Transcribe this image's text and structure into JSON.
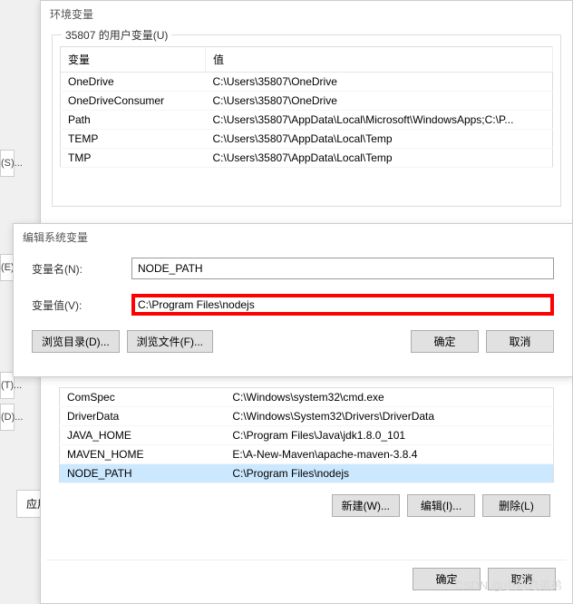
{
  "side_tabs": {
    "s": "(S)...",
    "e": "(E)...",
    "t": "(T)...",
    "d": "(D)..."
  },
  "side_label": "应用",
  "env_window": {
    "title": "环境变量",
    "user_group": "35807 的用户变量(U)",
    "col_var": "变量",
    "col_val": "值",
    "user_rows": [
      {
        "var": "OneDrive",
        "val": "C:\\Users\\35807\\OneDrive"
      },
      {
        "var": "OneDriveConsumer",
        "val": "C:\\Users\\35807\\OneDrive"
      },
      {
        "var": "Path",
        "val": "C:\\Users\\35807\\AppData\\Local\\Microsoft\\WindowsApps;C:\\P..."
      },
      {
        "var": "TEMP",
        "val": "C:\\Users\\35807\\AppData\\Local\\Temp"
      },
      {
        "var": "TMP",
        "val": "C:\\Users\\35807\\AppData\\Local\\Temp"
      }
    ],
    "sys_rows": [
      {
        "var": "ComSpec",
        "val": "C:\\Windows\\system32\\cmd.exe"
      },
      {
        "var": "DriverData",
        "val": "C:\\Windows\\System32\\Drivers\\DriverData"
      },
      {
        "var": "JAVA_HOME",
        "val": "C:\\Program Files\\Java\\jdk1.8.0_101"
      },
      {
        "var": "MAVEN_HOME",
        "val": "E:\\A-New-Maven\\apache-maven-3.8.4"
      },
      {
        "var": "NODE_PATH",
        "val": "C:\\Program Files\\nodejs",
        "sel": true
      }
    ],
    "btn_new": "新建(W)...",
    "btn_edit": "编辑(I)...",
    "btn_del": "删除(L)",
    "btn_ok": "确定",
    "btn_cancel": "取消"
  },
  "edit_window": {
    "title": "编辑系统变量",
    "label_name": "变量名(N):",
    "label_value": "变量值(V):",
    "value_name": "NODE_PATH",
    "value_value": "C:\\Program Files\\nodejs",
    "btn_browse_dir": "浏览目录(D)...",
    "btn_browse_file": "浏览文件(F)...",
    "btn_ok": "确定",
    "btn_cancel": "取消"
  },
  "watermark": "CSDN @小刘的弟弟"
}
